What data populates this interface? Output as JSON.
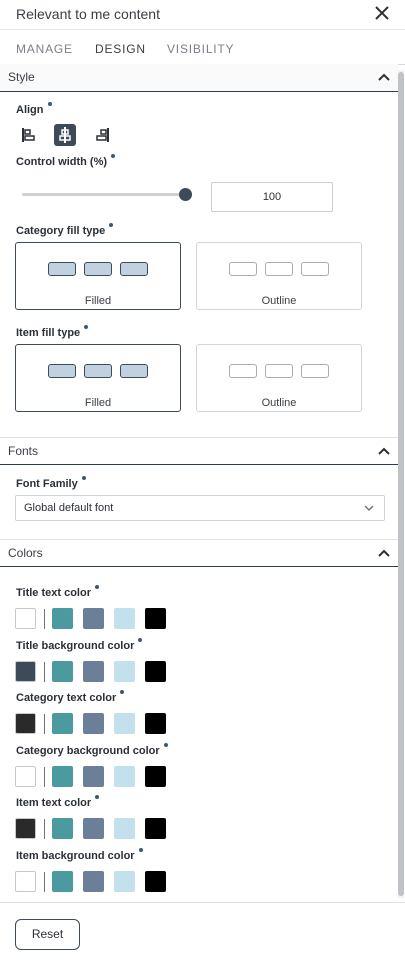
{
  "header": {
    "title": "Relevant to me content"
  },
  "tabs": [
    {
      "label": "MANAGE"
    },
    {
      "label": "DESIGN",
      "active": true
    },
    {
      "label": "VISIBILITY"
    }
  ],
  "style_section": {
    "title": "Style",
    "align": {
      "label": "Align",
      "options": [
        "align-left-icon",
        "align-center-icon",
        "align-right-icon"
      ],
      "selected": "center"
    },
    "control_width": {
      "label": "Control width (%)",
      "value": "100",
      "slider_percent": 100
    },
    "category_fill": {
      "label": "Category fill type",
      "options": [
        "Filled",
        "Outline"
      ],
      "selected": "Filled"
    },
    "item_fill": {
      "label": "Item fill type",
      "options": [
        "Filled",
        "Outline"
      ],
      "selected": "Filled"
    }
  },
  "fonts_section": {
    "title": "Fonts",
    "font_family": {
      "label": "Font Family",
      "value": "Global default font"
    }
  },
  "colors_section": {
    "title": "Colors",
    "palette": [
      "#4a9aa0",
      "#6c7f99",
      "#c2e1ec",
      "#000000"
    ],
    "rows": [
      {
        "label": "Title text color",
        "current": "#ffffff"
      },
      {
        "label": "Title background color",
        "current": "#3d4a57"
      },
      {
        "label": "Category text color",
        "current": "#2a2a2a"
      },
      {
        "label": "Category background color",
        "current": "#ffffff"
      },
      {
        "label": "Item text color",
        "current": "#2a2a2a"
      },
      {
        "label": "Item background color",
        "current": "#ffffff"
      }
    ]
  },
  "footer": {
    "reset_label": "Reset"
  },
  "colors": {
    "accent": "#3d4a57",
    "pill_fill": "#c1d1e0"
  }
}
